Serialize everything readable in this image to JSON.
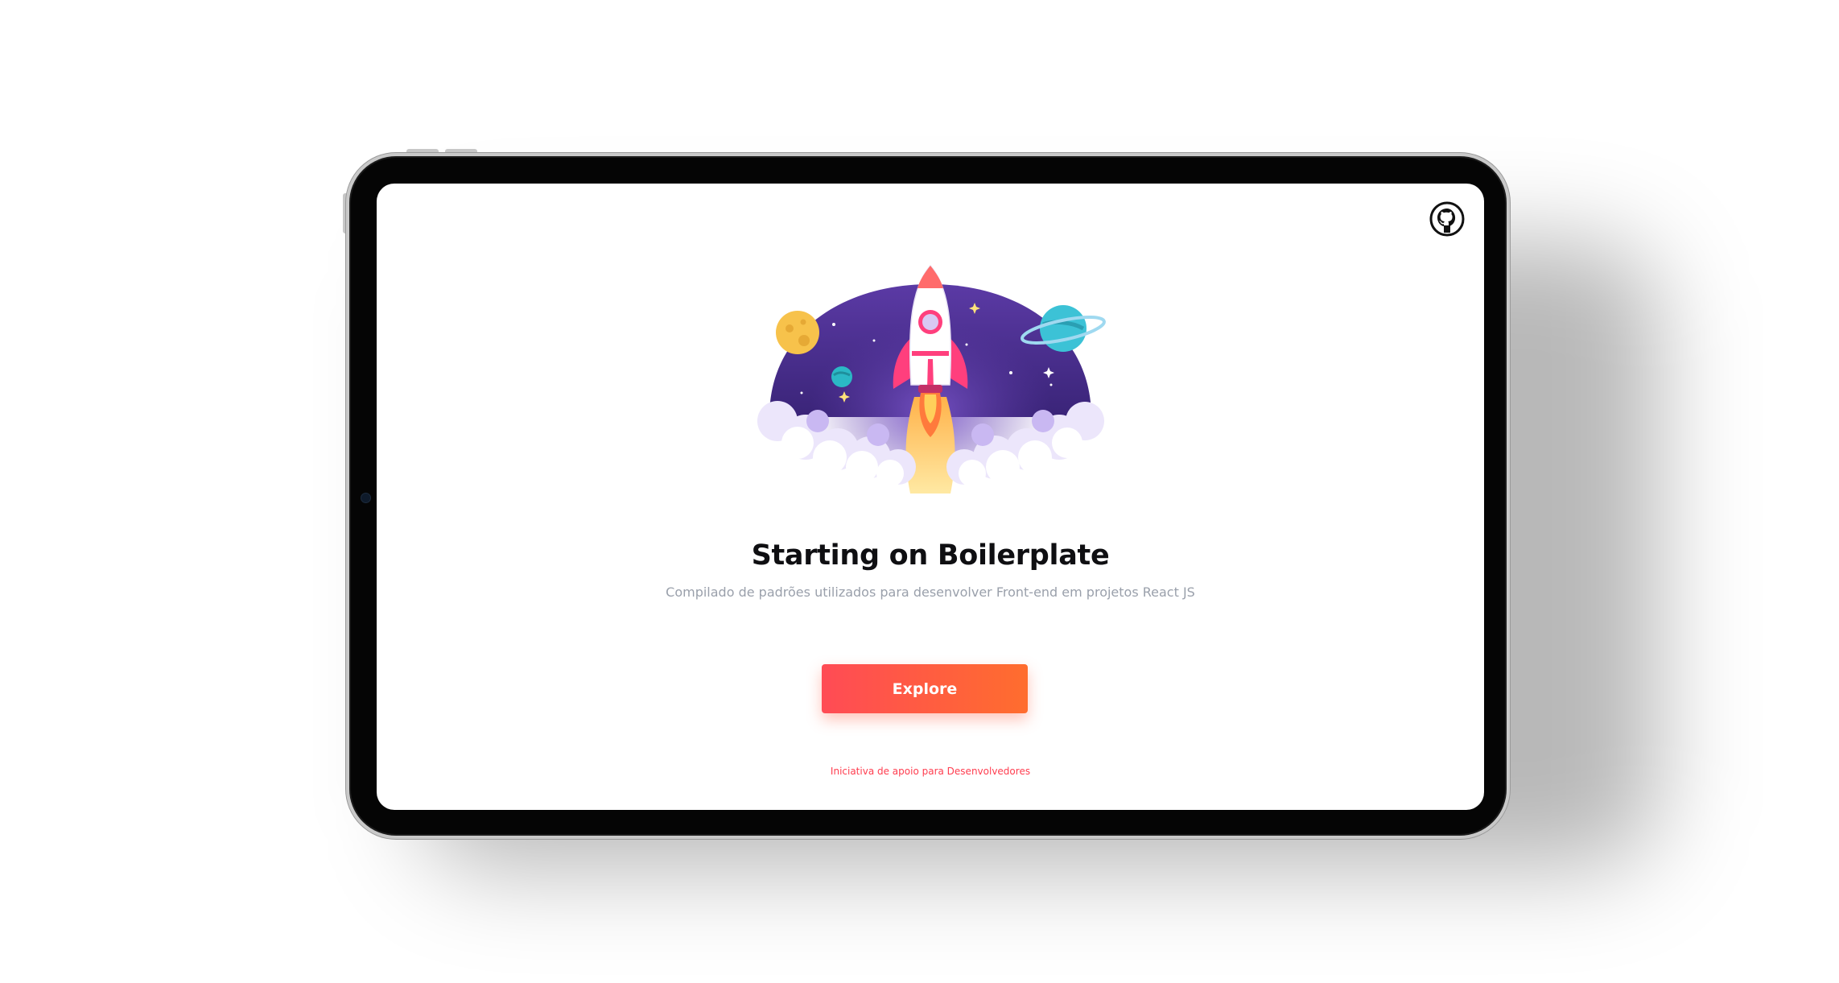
{
  "app": {
    "title": "Starting on Boilerplate",
    "subtitle": "Compilado de padrões utilizados para desenvolver Front-end em projetos React JS",
    "cta_label": "Explore",
    "footer": "Iniciativa de apoio para Desenvolvedores"
  },
  "icons": {
    "top_right": "github-icon",
    "hero": "rocket-launch-illustration"
  },
  "colors": {
    "title": "#0f0f12",
    "subtitle": "#9aa0ab",
    "button_start": "#ff4b55",
    "button_end": "#ff6d2e",
    "footer": "#ff3d4f",
    "space": "#4a2d8c"
  }
}
